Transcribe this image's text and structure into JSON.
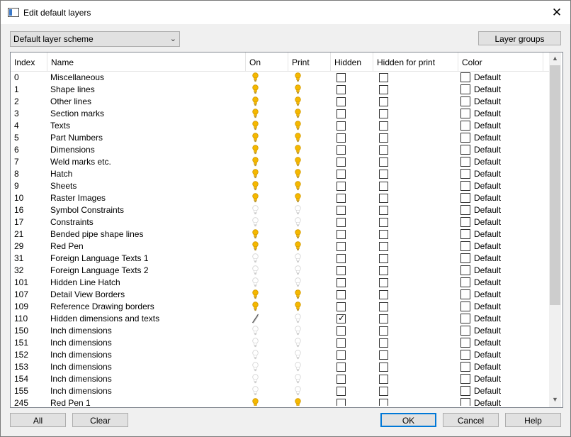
{
  "window": {
    "title": "Edit default layers"
  },
  "toolbar": {
    "scheme": "Default layer scheme",
    "layer_groups": "Layer groups"
  },
  "columns": {
    "index": "Index",
    "name": "Name",
    "on": "On",
    "print": "Print",
    "hidden": "Hidden",
    "hidden_for_print": "Hidden for print",
    "color": "Color"
  },
  "rows": [
    {
      "index": "0",
      "name": "Miscellaneous",
      "on": "on",
      "print": "on",
      "hidden": false,
      "hidden_print": false,
      "color": "Default"
    },
    {
      "index": "1",
      "name": "Shape lines",
      "on": "on",
      "print": "on",
      "hidden": false,
      "hidden_print": false,
      "color": "Default"
    },
    {
      "index": "2",
      "name": "Other lines",
      "on": "on",
      "print": "on",
      "hidden": false,
      "hidden_print": false,
      "color": "Default"
    },
    {
      "index": "3",
      "name": "Section marks",
      "on": "on",
      "print": "on",
      "hidden": false,
      "hidden_print": false,
      "color": "Default"
    },
    {
      "index": "4",
      "name": "Texts",
      "on": "on",
      "print": "on",
      "hidden": false,
      "hidden_print": false,
      "color": "Default"
    },
    {
      "index": "5",
      "name": "Part Numbers",
      "on": "on",
      "print": "on",
      "hidden": false,
      "hidden_print": false,
      "color": "Default"
    },
    {
      "index": "6",
      "name": "Dimensions",
      "on": "on",
      "print": "on",
      "hidden": false,
      "hidden_print": false,
      "color": "Default"
    },
    {
      "index": "7",
      "name": "Weld marks etc.",
      "on": "on",
      "print": "on",
      "hidden": false,
      "hidden_print": false,
      "color": "Default"
    },
    {
      "index": "8",
      "name": "Hatch",
      "on": "on",
      "print": "on",
      "hidden": false,
      "hidden_print": false,
      "color": "Default"
    },
    {
      "index": "9",
      "name": "Sheets",
      "on": "on",
      "print": "on",
      "hidden": false,
      "hidden_print": false,
      "color": "Default"
    },
    {
      "index": "10",
      "name": "Raster Images",
      "on": "on",
      "print": "on",
      "hidden": false,
      "hidden_print": false,
      "color": "Default"
    },
    {
      "index": "16",
      "name": "Symbol Constraints",
      "on": "off",
      "print": "off",
      "hidden": false,
      "hidden_print": false,
      "color": "Default"
    },
    {
      "index": "17",
      "name": "Constraints",
      "on": "off",
      "print": "off",
      "hidden": false,
      "hidden_print": false,
      "color": "Default"
    },
    {
      "index": "21",
      "name": "Bended pipe shape lines",
      "on": "on",
      "print": "on",
      "hidden": false,
      "hidden_print": false,
      "color": "Default"
    },
    {
      "index": "29",
      "name": "Red Pen",
      "on": "on",
      "print": "on",
      "hidden": false,
      "hidden_print": false,
      "color": "Default"
    },
    {
      "index": "31",
      "name": "Foreign Language Texts 1",
      "on": "off",
      "print": "off",
      "hidden": false,
      "hidden_print": false,
      "color": "Default"
    },
    {
      "index": "32",
      "name": "Foreign Language Texts 2",
      "on": "off",
      "print": "off",
      "hidden": false,
      "hidden_print": false,
      "color": "Default"
    },
    {
      "index": "101",
      "name": "Hidden Line Hatch",
      "on": "off",
      "print": "off",
      "hidden": false,
      "hidden_print": false,
      "color": "Default"
    },
    {
      "index": "107",
      "name": "Detail View Borders",
      "on": "on",
      "print": "on",
      "hidden": false,
      "hidden_print": false,
      "color": "Default"
    },
    {
      "index": "109",
      "name": "Reference Drawing borders",
      "on": "on",
      "print": "on",
      "hidden": false,
      "hidden_print": false,
      "color": "Default"
    },
    {
      "index": "110",
      "name": "Hidden dimensions and texts",
      "on": "slash",
      "print": "off",
      "hidden": true,
      "hidden_print": false,
      "color": "Default"
    },
    {
      "index": "150",
      "name": "Inch dimensions",
      "on": "off",
      "print": "off",
      "hidden": false,
      "hidden_print": false,
      "color": "Default"
    },
    {
      "index": "151",
      "name": "Inch dimensions",
      "on": "off",
      "print": "off",
      "hidden": false,
      "hidden_print": false,
      "color": "Default"
    },
    {
      "index": "152",
      "name": "Inch dimensions",
      "on": "off",
      "print": "off",
      "hidden": false,
      "hidden_print": false,
      "color": "Default"
    },
    {
      "index": "153",
      "name": "Inch dimensions",
      "on": "off",
      "print": "off",
      "hidden": false,
      "hidden_print": false,
      "color": "Default"
    },
    {
      "index": "154",
      "name": "Inch dimensions",
      "on": "off",
      "print": "off",
      "hidden": false,
      "hidden_print": false,
      "color": "Default"
    },
    {
      "index": "155",
      "name": "Inch dimensions",
      "on": "off",
      "print": "off",
      "hidden": false,
      "hidden_print": false,
      "color": "Default"
    },
    {
      "index": "245",
      "name": "Red Pen 1",
      "on": "on",
      "print": "on",
      "hidden": false,
      "hidden_print": false,
      "color": "Default"
    }
  ],
  "footer": {
    "all": "All",
    "clear": "Clear",
    "ok": "OK",
    "cancel": "Cancel",
    "help": "Help"
  },
  "colors": {
    "bulb_on": "#f5b800",
    "bulb_off": "#d4d4d4",
    "accent": "#0078d7"
  },
  "icons": {
    "close": "close-icon",
    "dropdown": "chevron-down-icon",
    "on": "lightbulb-icon",
    "off": "lightbulb-off-icon",
    "scroll_up": "scroll-up-icon",
    "scroll_down": "scroll-down-icon"
  }
}
